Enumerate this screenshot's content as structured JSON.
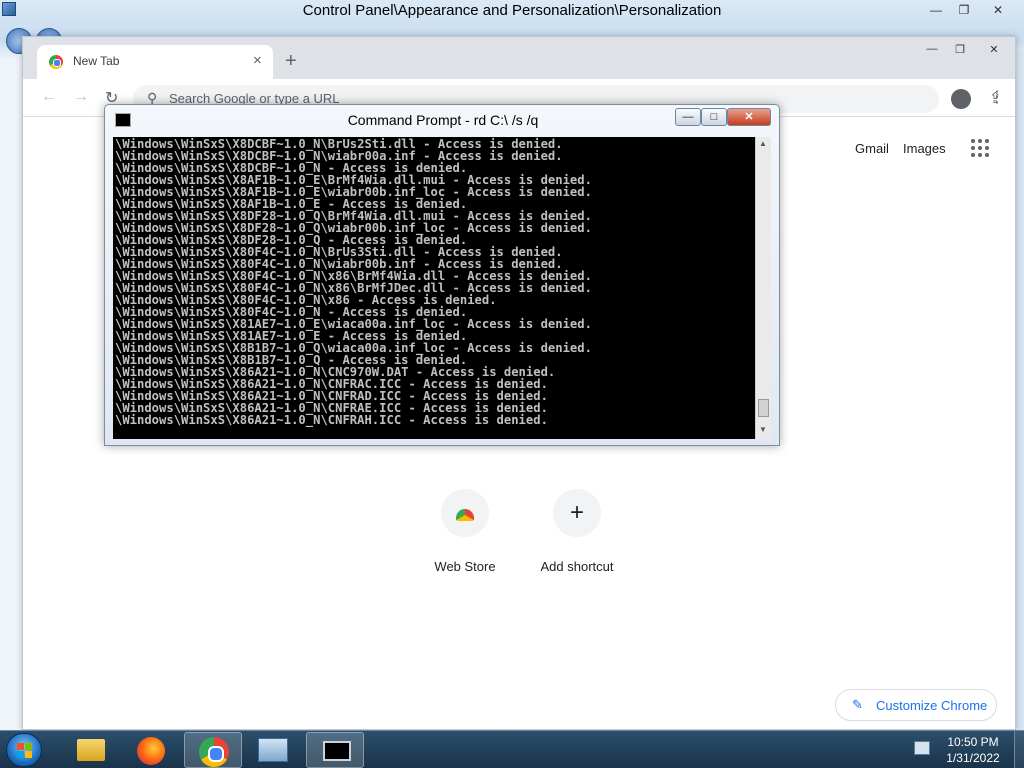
{
  "control_panel": {
    "title": "Control Panel\\Appearance and Personalization\\Personalization",
    "controls": {
      "minimize": "—",
      "maximize": "❐",
      "close": "✕"
    }
  },
  "chrome": {
    "tab": {
      "title": "New Tab",
      "close": "×"
    },
    "new_tab": "+",
    "controls": {
      "minimize": "—",
      "maximize": "❐",
      "close": "✕"
    },
    "toolbar": {
      "back": "←",
      "forward": "→",
      "reload": "↻",
      "omnibox_placeholder": "Search Google or type a URL",
      "share": "⇪",
      "bookmark": "☆",
      "menu": "⋮"
    },
    "header_links": {
      "gmail": "Gmail",
      "images": "Images"
    },
    "shortcuts": [
      {
        "label": "Web Store",
        "icon": "webstore-icon"
      },
      {
        "label": "Add shortcut",
        "icon": "add-icon",
        "glyph": "+"
      }
    ],
    "customize": {
      "label": "Customize Chrome",
      "icon": "pencil-icon",
      "glyph": "✎"
    },
    "accent_color": "#1a73e8"
  },
  "cmd": {
    "title": "Command Prompt - rd  C:\\ /s /q",
    "controls": {
      "minimize": "—",
      "maximize": "□",
      "close": "✕"
    },
    "lines": [
      "\\Windows\\WinSxS\\X8DCBF~1.0_N\\BrUs2Sti.dll - Access is denied.",
      "\\Windows\\WinSxS\\X8DCBF~1.0_N\\wiabr00a.inf - Access is denied.",
      "\\Windows\\WinSxS\\X8DCBF~1.0_N - Access is denied.",
      "\\Windows\\WinSxS\\X8AF1B~1.0_E\\BrMf4Wia.dll.mui - Access is denied.",
      "\\Windows\\WinSxS\\X8AF1B~1.0_E\\wiabr00b.inf_loc - Access is denied.",
      "\\Windows\\WinSxS\\X8AF1B~1.0_E - Access is denied.",
      "\\Windows\\WinSxS\\X8DF28~1.0_Q\\BrMf4Wia.dll.mui - Access is denied.",
      "\\Windows\\WinSxS\\X8DF28~1.0_Q\\wiabr00b.inf_loc - Access is denied.",
      "\\Windows\\WinSxS\\X8DF28~1.0_Q - Access is denied.",
      "\\Windows\\WinSxS\\X80F4C~1.0_N\\BrUs3Sti.dll - Access is denied.",
      "\\Windows\\WinSxS\\X80F4C~1.0_N\\wiabr00b.inf - Access is denied.",
      "\\Windows\\WinSxS\\X80F4C~1.0_N\\x86\\BrMf4Wia.dll - Access is denied.",
      "\\Windows\\WinSxS\\X80F4C~1.0_N\\x86\\BrMfJDec.dll - Access is denied.",
      "\\Windows\\WinSxS\\X80F4C~1.0_N\\x86 - Access is denied.",
      "\\Windows\\WinSxS\\X80F4C~1.0_N - Access is denied.",
      "\\Windows\\WinSxS\\X81AE7~1.0_E\\wiaca00a.inf_loc - Access is denied.",
      "\\Windows\\WinSxS\\X81AE7~1.0_E - Access is denied.",
      "\\Windows\\WinSxS\\X8B1B7~1.0_Q\\wiaca00a.inf_loc - Access is denied.",
      "\\Windows\\WinSxS\\X8B1B7~1.0_Q - Access is denied.",
      "\\Windows\\WinSxS\\X86A21~1.0_N\\CNC970W.DAT - Access is denied.",
      "\\Windows\\WinSxS\\X86A21~1.0_N\\CNFRAC.ICC - Access is denied.",
      "\\Windows\\WinSxS\\X86A21~1.0_N\\CNFRAD.ICC - Access is denied.",
      "\\Windows\\WinSxS\\X86A21~1.0_N\\CNFRAE.ICC - Access is denied.",
      "\\Windows\\WinSxS\\X86A21~1.0_N\\CNFRAH.ICC - Access is denied."
    ],
    "scroll": {
      "up": "▲",
      "down": "▼"
    }
  },
  "taskbar": {
    "apps": [
      {
        "name": "explorer-icon",
        "active": false
      },
      {
        "name": "firefox-icon",
        "active": false
      },
      {
        "name": "chrome-icon",
        "active": true
      },
      {
        "name": "network-icon",
        "active": false
      },
      {
        "name": "cmd-icon",
        "active": true
      }
    ],
    "clock": {
      "time": "10:50 PM",
      "date": "1/31/2022"
    }
  }
}
